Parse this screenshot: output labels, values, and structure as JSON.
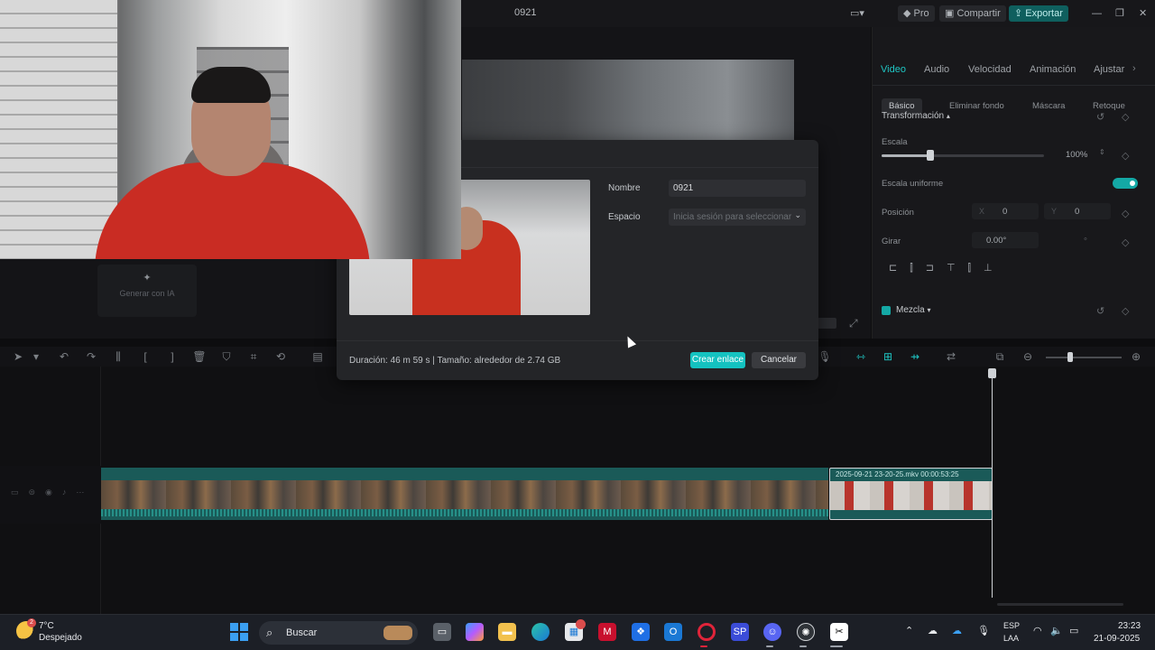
{
  "titlebar": {
    "title": "0921",
    "pro": "Pro",
    "share": "Compartir",
    "export": "Exportar"
  },
  "left_panel": {
    "generate_ai": "Generar con IA"
  },
  "props": {
    "tabs": [
      "Video",
      "Audio",
      "Velocidad",
      "Animación",
      "Ajustar"
    ],
    "subtabs": [
      "Básico",
      "Eliminar fondo",
      "Máscara",
      "Retoque"
    ],
    "transform": "Transformación",
    "scale": "Escala",
    "scale_value": "100%",
    "scale_fraction": 0.3,
    "uniform_scale": "Escala uniforme",
    "position": "Posición",
    "pos_x_label": "X",
    "pos_x": "0",
    "pos_y_label": "Y",
    "pos_y": "0",
    "rotate": "Girar",
    "rotate_value": "0.00°",
    "blend": "Mezcla",
    "accent": "#1fc6c4"
  },
  "dialog": {
    "name_label": "Nombre",
    "name_value": "0921",
    "space_label": "Espacio",
    "space_placeholder": "Inicia sesión para seleccionar",
    "info": "Duración: 46 m 59 s | Tamaño: alrededor de 2.74 GB",
    "create": "Crear enlace",
    "cancel": "Cancelar"
  },
  "timeline": {
    "selected_clip_name": "2025-09-21 23-20-25.mkv",
    "selected_clip_duration": "00:00:53:25"
  },
  "taskbar": {
    "temp": "7°C",
    "weather": "Despejado",
    "weather_badge": "2",
    "search": "Buscar",
    "lang1": "ESP",
    "lang2": "LAA",
    "time": "23:23",
    "date": "21-09-2025",
    "apps": [
      "task-view-icon",
      "copilot-icon",
      "file-explorer-icon",
      "edge-icon",
      "store-icon",
      "mcafee-icon",
      "dropbox-icon",
      "outlook-icon",
      "opera-icon",
      "sp-icon",
      "discord-icon",
      "chatgpt-icon",
      "capcut-icon"
    ]
  }
}
